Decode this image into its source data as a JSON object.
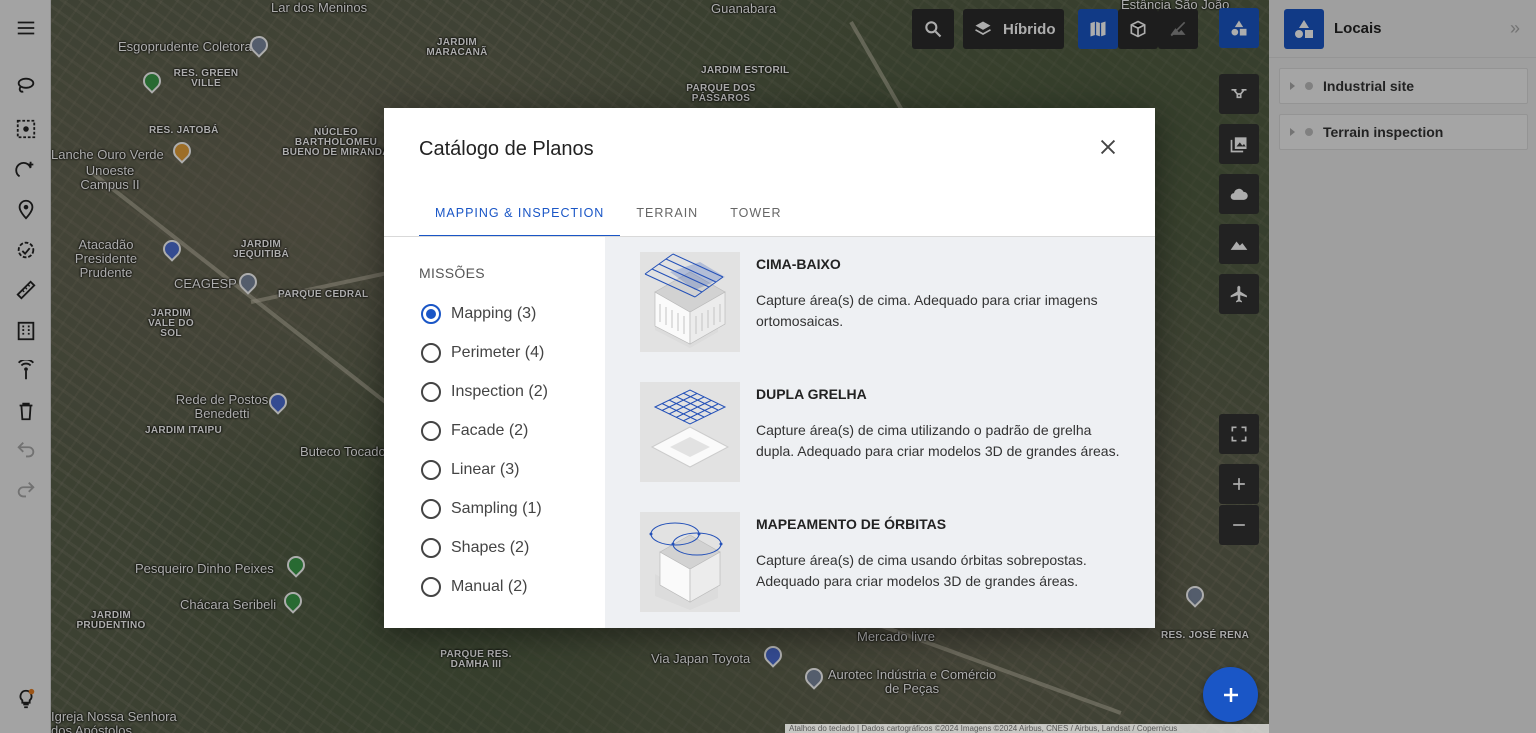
{
  "map": {
    "labels": [
      "Esgoprudente Coletora",
      "Lar dos Meninos",
      "Guanabara",
      "Estância São João",
      "Lanche Ouro Verde",
      "Unoeste Campus II",
      "Atacadão Presidente Prudente",
      "CEAGESP",
      "Rede de Postos Benedetti",
      "Buteco Tocado",
      "Pesqueiro Dinho Peixes",
      "Chácara Seribeli",
      "Mercado livre",
      "Via Japan Toyota",
      "Aurotec Indústria e Comércio de Peças",
      "Igreja Nossa Senhora dos Apóstolos"
    ],
    "small_labels": [
      "JARDIM MARACANÃ",
      "JARDIM ESTORIL",
      "PARQUE DOS PÁSSAROS",
      "RES. GREEN VILLE",
      "RES. JATOBÁ",
      "NÚCLEO BARTHOLOMEU BUENO DE MIRANDA",
      "JARDIM JEQUITIBÁ",
      "PARQUE CEDRAL",
      "JARDIM VALE DO SOL",
      "JARDIM ITAIPU",
      "PARQUE RES. DAMHA III",
      "RES. JOSÉ RENA",
      "JARDIM PRUDENTINO"
    ],
    "attribution": "Atalhos do teclado | Dados cartográficos ©2024 Imagens ©2024 Airbus, CNES / Airbus, Landsat / Copernicus"
  },
  "map_controls": {
    "layer_label": "Híbrido"
  },
  "right_panel": {
    "title": "Locais",
    "items": [
      {
        "label": "Industrial site"
      },
      {
        "label": "Terrain inspection"
      }
    ]
  },
  "modal": {
    "title": "Catálogo de Planos",
    "tabs": [
      {
        "label": "MAPPING & INSPECTION",
        "active": true
      },
      {
        "label": "TERRAIN",
        "active": false
      },
      {
        "label": "TOWER",
        "active": false
      }
    ],
    "missions_title": "MISSÕES",
    "missions": [
      {
        "label": "Mapping (3)",
        "checked": true
      },
      {
        "label": "Perimeter (4)",
        "checked": false
      },
      {
        "label": "Inspection (2)",
        "checked": false
      },
      {
        "label": "Facade (2)",
        "checked": false
      },
      {
        "label": "Linear (3)",
        "checked": false
      },
      {
        "label": "Sampling (1)",
        "checked": false
      },
      {
        "label": "Shapes (2)",
        "checked": false
      },
      {
        "label": "Manual (2)",
        "checked": false
      }
    ],
    "plans": [
      {
        "title": "CIMA-BAIXO",
        "description": "Capture área(s) de cima. Adequado para criar imagens ortomosaicas."
      },
      {
        "title": "DUPLA GRELHA",
        "description": "Capture área(s) de cima utilizando o padrão de grelha dupla. Adequado para criar modelos 3D de grandes áreas."
      },
      {
        "title": "MAPEAMENTO DE ÓRBITAS",
        "description": "Capture área(s) de cima usando órbitas sobrepostas. Adequado para criar modelos 3D de grandes áreas."
      }
    ]
  },
  "colors": {
    "accent": "#1a56c6",
    "toolbar_dark": "#2b2b2b"
  }
}
